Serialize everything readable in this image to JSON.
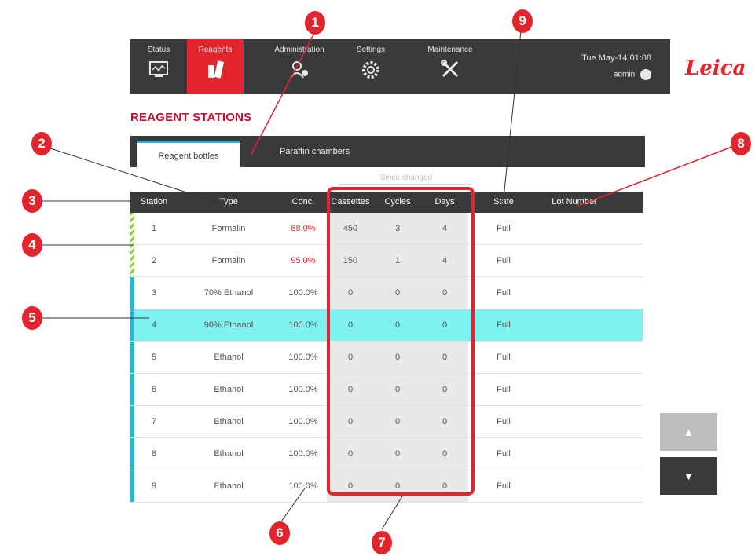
{
  "nav": {
    "tabs": [
      {
        "label": "Status",
        "icon": "status-icon"
      },
      {
        "label": "Reagents",
        "icon": "reagents-icon"
      },
      {
        "label": "Administration",
        "icon": "administration-icon"
      },
      {
        "label": "Settings",
        "icon": "settings-gear-icon"
      },
      {
        "label": "Maintenance",
        "icon": "maintenance-tools-icon"
      }
    ],
    "active_tab": "Reagents",
    "datetime": "Tue May-14 01:08",
    "user": "admin"
  },
  "brand": "Leica",
  "page_title": "REAGENT STATIONS",
  "subtabs": [
    "Reagent bottles",
    "Paraffin chambers"
  ],
  "since_changed": "Since changed",
  "table": {
    "headers": [
      "Station",
      "Type",
      "Conc.",
      "Cassettes",
      "Cycles",
      "Days",
      "State",
      "Lot Number"
    ],
    "rows": [
      {
        "station": "1",
        "type": "Formalin",
        "conc": "88.0%",
        "cassettes": "450",
        "cycles": "3",
        "days": "4",
        "state": "Full",
        "lot": ""
      },
      {
        "station": "2",
        "type": "Formalin",
        "conc": "95.0%",
        "cassettes": "150",
        "cycles": "1",
        "days": "4",
        "state": "Full",
        "lot": ""
      },
      {
        "station": "3",
        "type": "70% Ethanol",
        "conc": "100.0%",
        "cassettes": "0",
        "cycles": "0",
        "days": "0",
        "state": "Full",
        "lot": ""
      },
      {
        "station": "4",
        "type": "90% Ethanol",
        "conc": "100.0%",
        "cassettes": "0",
        "cycles": "0",
        "days": "0",
        "state": "Full",
        "lot": ""
      },
      {
        "station": "5",
        "type": "Ethanol",
        "conc": "100.0%",
        "cassettes": "0",
        "cycles": "0",
        "days": "0",
        "state": "Full",
        "lot": ""
      },
      {
        "station": "6",
        "type": "Ethanol",
        "conc": "100.0%",
        "cassettes": "0",
        "cycles": "0",
        "days": "0",
        "state": "Full",
        "lot": ""
      },
      {
        "station": "7",
        "type": "Ethanol",
        "conc": "100.0%",
        "cassettes": "0",
        "cycles": "0",
        "days": "0",
        "state": "Full",
        "lot": ""
      },
      {
        "station": "8",
        "type": "Ethanol",
        "conc": "100.0%",
        "cassettes": "0",
        "cycles": "0",
        "days": "0",
        "state": "Full",
        "lot": ""
      },
      {
        "station": "9",
        "type": "Ethanol",
        "conc": "100.0%",
        "cassettes": "0",
        "cycles": "0",
        "days": "0",
        "state": "Full",
        "lot": ""
      }
    ],
    "selected_station": "4",
    "red_conc_stations": [
      "1",
      "2"
    ],
    "hatched_stations": [
      "1",
      "2"
    ]
  },
  "scroll": {
    "up_icon": "arrow-up-icon",
    "down_icon": "arrow-down-icon"
  },
  "callouts": [
    "1",
    "2",
    "3",
    "4",
    "5",
    "6",
    "7",
    "8",
    "9"
  ],
  "colors": {
    "accent": "#e2242c",
    "selection": "#7ef2f0",
    "header": "#3a3a3d",
    "status_bar": "#2fb2d6"
  }
}
